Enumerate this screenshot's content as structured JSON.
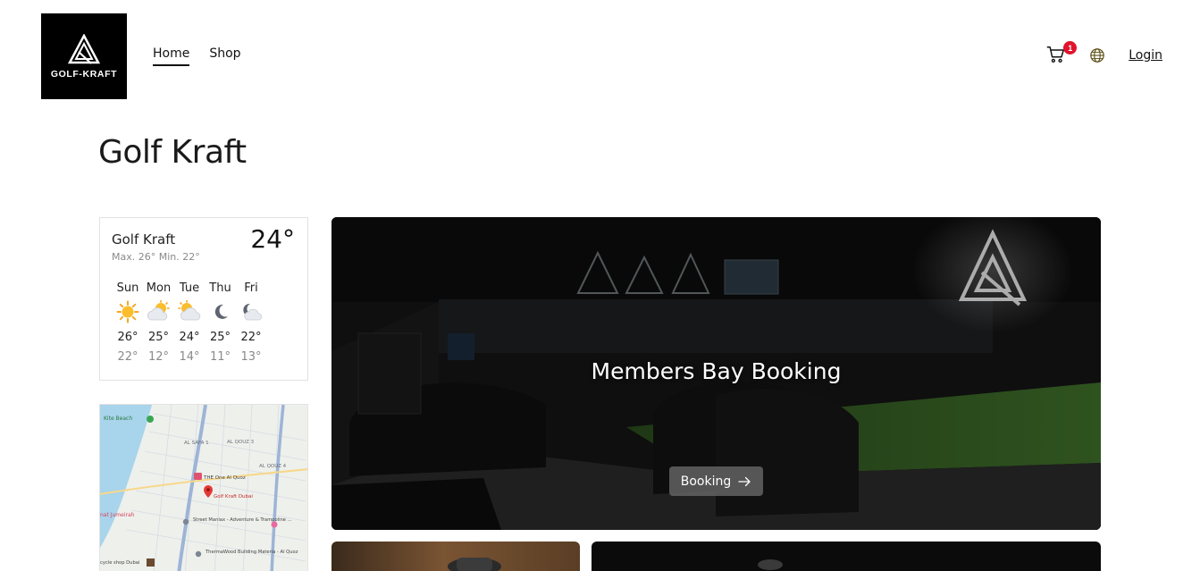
{
  "header": {
    "logo_text": "GOLF-KRAFT",
    "nav": [
      {
        "label": "Home",
        "active": true
      },
      {
        "label": "Shop",
        "active": false
      }
    ],
    "cart_count": "1",
    "login_label": "Login"
  },
  "page_title": "Golf Kraft",
  "weather": {
    "location": "Golf Kraft",
    "current_temp": "24°",
    "minmax": "Max. 26° Min. 22°",
    "days": [
      {
        "name": "Sun",
        "icon": "sun-icon",
        "hi": "26°",
        "lo": "22°"
      },
      {
        "name": "Mon",
        "icon": "partly-cloudy-icon",
        "hi": "25°",
        "lo": "12°"
      },
      {
        "name": "Tue",
        "icon": "partly-cloudy-icon",
        "hi": "24°",
        "lo": "14°"
      },
      {
        "name": "Thu",
        "icon": "moon-icon",
        "hi": "25°",
        "lo": "11°"
      },
      {
        "name": "Fri",
        "icon": "cloudy-night-icon",
        "hi": "22°",
        "lo": "13°"
      }
    ]
  },
  "map": {
    "labels": {
      "kite_beach": "Kite Beach",
      "al_safa_1": "AL SAFA 1",
      "al_qouz_3": "AL QOUZ 3",
      "al_qouz_4": "AL QOUZ 4",
      "the_one": "THE One Al Quoz",
      "golf_kraft": "Golf Kraft Dubai",
      "jumeirah": "nat Jumeirah",
      "street_maniax": "Street Maniax - Adventure & Trampoline ...",
      "thermawood": "ThermaWood Building Materia - Al Quoz",
      "bicycle_shop": "cycle shop Dubai"
    }
  },
  "hero": {
    "title": "Members Bay Booking",
    "button_label": "Booking"
  },
  "colors": {
    "badge": "#e0142c",
    "turf": "#3f7a2a",
    "map_pin": "#e53935"
  }
}
